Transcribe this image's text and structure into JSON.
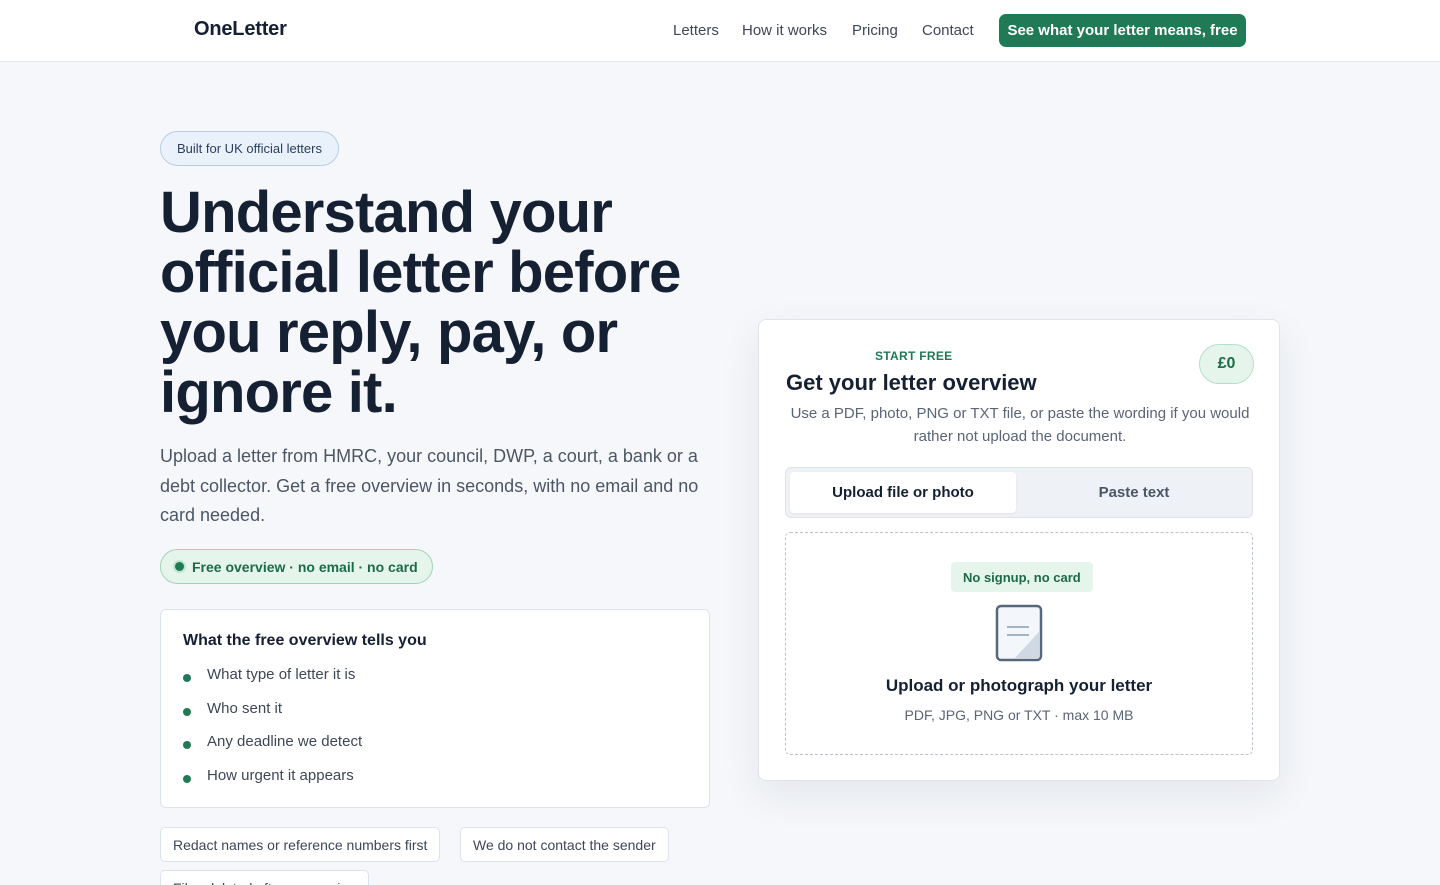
{
  "header": {
    "brand": "OneLetter",
    "nav": {
      "letters": "Letters",
      "how_it_works": "How it works",
      "pricing": "Pricing",
      "contact": "Contact"
    },
    "cta": "See what your letter means, free"
  },
  "hero": {
    "badge": "Built for UK official letters",
    "headline": "Understand your official letter before you reply, pay, or ignore it.",
    "lede": "Upload a letter from HMRC, your council, DWP, a court, a bank or a debt collector. Get a free overview in seconds, with no email and no card needed.",
    "pill": "Free overview · no email · no card",
    "info_card": {
      "title": "What the free overview tells you",
      "items": [
        "What type of letter it is",
        "Who sent it",
        "Any deadline we detect",
        "How urgent it appears"
      ]
    },
    "chips": [
      "Redact names or reference numbers first",
      "We do not contact the sender",
      "Files deleted after processing"
    ]
  },
  "upload_panel": {
    "eyebrow": "START FREE",
    "title": "Get your letter overview",
    "price": "£0",
    "description": "Use a PDF, photo, PNG or TXT file, or paste the wording if you would rather not upload the document.",
    "tabs": {
      "upload": "Upload file or photo",
      "paste": "Paste text"
    },
    "dropzone": {
      "badge": "No signup, no card",
      "icon": "document-icon",
      "title": "Upload or photograph your letter",
      "subtitle": "PDF, JPG, PNG or TXT · max 10 MB"
    }
  },
  "colors": {
    "accent": "#1f7a55",
    "heading": "#152033",
    "background": "#f5f7fa"
  }
}
